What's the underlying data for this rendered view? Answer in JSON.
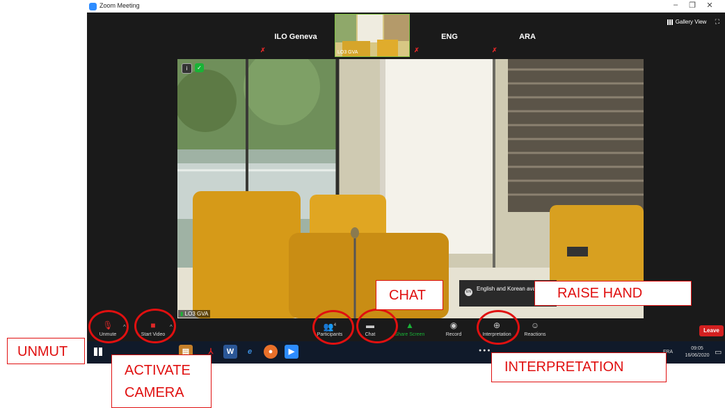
{
  "window": {
    "title": "Zoom Meeting",
    "minimize": "–",
    "restore": "❐",
    "close": "✕"
  },
  "strip": {
    "tiles": [
      {
        "label": "ILO Geneva"
      },
      {
        "label": "ENG"
      },
      {
        "label": "ARA"
      }
    ],
    "thumb_label": "LO3 GVA",
    "gallery_label": "Gallery View",
    "fullscreen_icon": "⛶"
  },
  "video": {
    "name_tag": "LO3 GVA"
  },
  "toast": {
    "text": "English and Korean available!",
    "icon": "EN"
  },
  "toolbar": {
    "unmute": "Unmute",
    "start_video": "Start Video",
    "participants": "Participants",
    "participants_count": "4",
    "chat": "Chat",
    "share_screen": "Share Screen",
    "record": "Record",
    "interpretation": "Interpretation",
    "reactions": "Reactions",
    "leave": "Leave",
    "caret": "^"
  },
  "taskbar": {
    "lang": "FRA",
    "time": "09:05",
    "date": "16/06/2020"
  },
  "annotations": {
    "unmute": "UNMUT",
    "activate_line1": "ACTIVATE",
    "activate_line2": "CAMERA",
    "chat": "CHAT",
    "raise_hand": "RAISE HAND",
    "interpretation": "INTERPRETATION"
  },
  "colors": {
    "accent_green": "#19b336",
    "leave_red": "#d32020",
    "annotation_red": "#e01010",
    "zoom_blue": "#2d8cff"
  }
}
